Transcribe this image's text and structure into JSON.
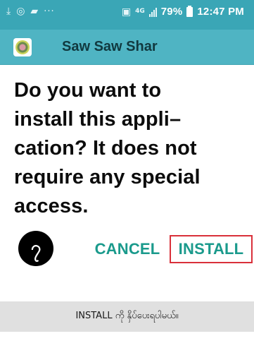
{
  "status_bar": {
    "icons": [
      "download-icon",
      "messenger-icon",
      "video-icon",
      "more-dots-icon",
      "sim-icon",
      "lte-icon",
      "signal-icon",
      "battery-icon"
    ],
    "network": "4G",
    "battery_percent": "79%",
    "time": "12:47 PM"
  },
  "title_bar": {
    "app_name": "Saw Saw Shar"
  },
  "dialog": {
    "message": "Do you want to\ninstall this appli–\ncation? It does not\nrequire any special\naccess.",
    "cancel_label": "CANCEL",
    "install_label": "INSTALL"
  },
  "annotation": {
    "step_number": "၇",
    "caption": "INSTALL ကို နှိပ်ပေးရပါမယ်။",
    "highlight_color": "#d9303a"
  },
  "colors": {
    "status_bar": "#3aa6b6",
    "title_bar": "#4fb4c3",
    "button_text": "#1a9a8c",
    "caption_bg": "#e0e0e0"
  }
}
